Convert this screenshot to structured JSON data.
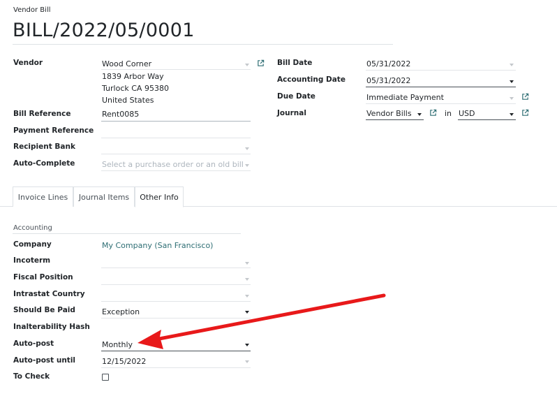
{
  "header": {
    "doc_type": "Vendor Bill",
    "name": "BILL/2022/05/0001"
  },
  "left_fields": {
    "vendor_label": "Vendor",
    "vendor_value": "Wood Corner",
    "vendor_address_1": "1839 Arbor Way",
    "vendor_address_2": "Turlock CA 95380",
    "vendor_address_3": "United States",
    "bill_reference_label": "Bill Reference",
    "bill_reference_value": "Rent0085",
    "payment_reference_label": "Payment Reference",
    "payment_reference_value": "",
    "recipient_bank_label": "Recipient Bank",
    "recipient_bank_value": "",
    "auto_complete_label": "Auto-Complete",
    "auto_complete_placeholder": "Select a purchase order or an old bill"
  },
  "right_fields": {
    "bill_date_label": "Bill Date",
    "bill_date_value": "05/31/2022",
    "accounting_date_label": "Accounting Date",
    "accounting_date_value": "05/31/2022",
    "due_date_label": "Due Date",
    "due_date_value": "Immediate Payment",
    "journal_label": "Journal",
    "journal_value": "Vendor Bills",
    "journal_in": "in",
    "currency_value": "USD"
  },
  "tabs": [
    {
      "label": "Invoice Lines",
      "active": false
    },
    {
      "label": "Journal Items",
      "active": false
    },
    {
      "label": "Other Info",
      "active": true
    }
  ],
  "other_info": {
    "section_title": "Accounting",
    "company_label": "Company",
    "company_value": "My Company (San Francisco)",
    "incoterm_label": "Incoterm",
    "incoterm_value": "",
    "fiscal_position_label": "Fiscal Position",
    "fiscal_position_value": "",
    "intrastat_country_label": "Intrastat Country",
    "intrastat_country_value": "",
    "should_be_paid_label": "Should Be Paid",
    "should_be_paid_value": "Exception",
    "inalterability_hash_label": "Inalterability Hash",
    "inalterability_hash_value": "",
    "auto_post_label": "Auto-post",
    "auto_post_value": "Monthly",
    "auto_post_until_label": "Auto-post until",
    "auto_post_until_value": "12/15/2022",
    "to_check_label": "To Check",
    "to_check_value": false
  },
  "annotation": {
    "arrow_color": "#e8191a",
    "points_to": "auto-post-field"
  },
  "colors": {
    "link": "#2e6e74",
    "text": "#212529",
    "muted": "#adb5bd",
    "annotation": "#e8191a"
  },
  "icons": {
    "external_link": "external-link-icon",
    "dropdown": "caret-down-icon"
  }
}
